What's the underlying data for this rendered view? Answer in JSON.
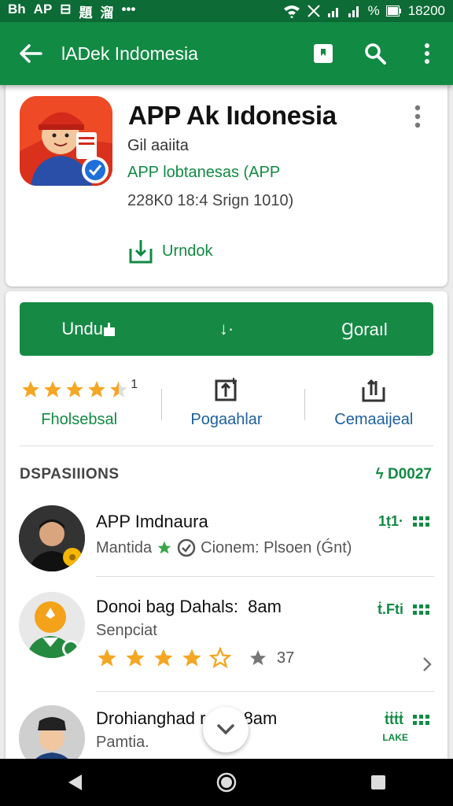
{
  "status_bar": {
    "left_items": [
      "Bh",
      "AP",
      "⊟",
      "題",
      "溜",
      "•••"
    ],
    "time": "18200"
  },
  "app_bar": {
    "title": "lADek Indomesia",
    "icons": [
      "back-arrow-icon",
      "bookmark-icon",
      "search-icon",
      "more-vert-icon"
    ]
  },
  "app_header": {
    "title": "APP Ak Iıdonesia",
    "developer": "Gil aaiita",
    "category": "APP lobtanesas (APP",
    "meta": "228K0  18:4 Srign 1010)",
    "action_label": "Urndok"
  },
  "primary_button": {
    "left_label": "Undu",
    "middle_label": "↓·",
    "right_label": "Ɡoraıl"
  },
  "stats": [
    {
      "label": "Fholsebsal",
      "rating_text": "1",
      "rating": 4.5
    },
    {
      "label": "Pogaahlar"
    },
    {
      "label": "Cemaaijeal"
    }
  ],
  "section": {
    "title": "DSPASIIIONS",
    "code": "ϟ D0027"
  },
  "items": [
    {
      "name": "APP Imdnaura",
      "sub_a": "Mantida",
      "sub_b": "Cionem: Plsoen (Ǵnt)",
      "right_code": "1ṭ1·"
    },
    {
      "name": "Donoi bag Dahals:",
      "time": "8am",
      "sub": "Senpciat",
      "rating_count": "37",
      "rating": 4,
      "right_code": "ṫ.Fti"
    },
    {
      "name": "Drohianghad r",
      "time": "8am",
      "sub": "Pamtia.",
      "right_code": "ṫṫṫṫ",
      "right_sub": "LAKE"
    }
  ],
  "colors": {
    "primary": "#118a43",
    "primary_dark": "#0d6b36",
    "star": "#f5a623"
  }
}
